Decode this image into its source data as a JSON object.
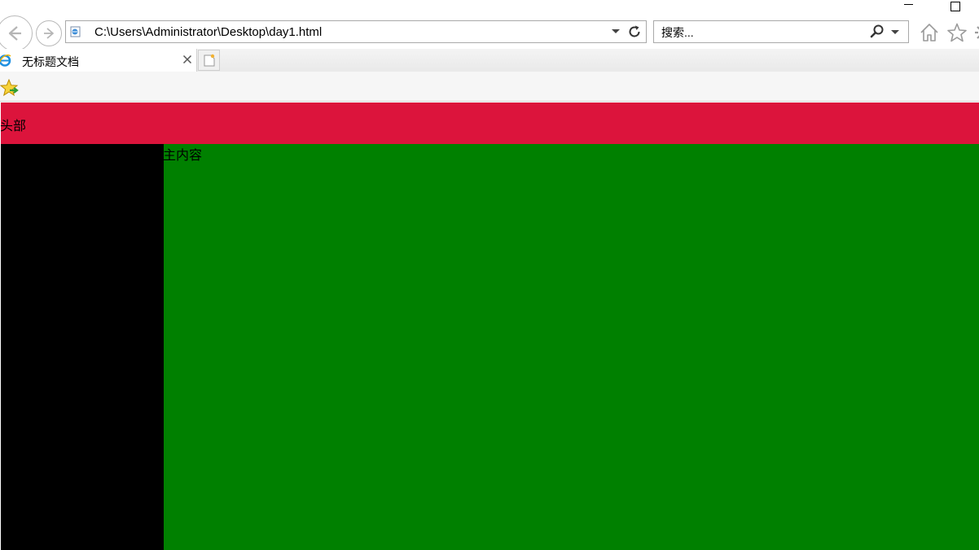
{
  "browser": {
    "address": {
      "url": "C:\\Users\\Administrator\\Desktop\\day1.html"
    },
    "search": {
      "placeholder": "搜索..."
    },
    "tabs": [
      {
        "title": "无标题文档",
        "active": true
      }
    ],
    "icons": {
      "back": "back-arrow-icon",
      "forward": "forward-arrow-icon",
      "refresh": "refresh-icon",
      "search": "magnifier-icon",
      "home": "home-icon",
      "favorites": "star-icon",
      "tools": "gear-icon",
      "add_favorite": "star-arrow-icon",
      "tab": "ie-logo-icon",
      "close": "close-icon",
      "new_tab": "new-tab-icon"
    }
  },
  "page": {
    "header_text": "头部",
    "main_text": "主内容",
    "colors": {
      "header": "#dc143c",
      "sidebar": "#000000",
      "main": "#008000"
    }
  }
}
